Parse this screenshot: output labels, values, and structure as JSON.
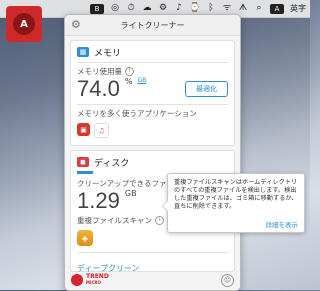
{
  "menubar": {
    "badge": "B",
    "items": [
      "◎",
      "⏱",
      "☁",
      "⚙",
      "♪",
      "⌚",
      "ᛒ",
      "ᯤ",
      "ᗑ",
      "⌕"
    ],
    "input_badge": "A",
    "input_label": "英字"
  },
  "desktop": {
    "app_icon_label": "A"
  },
  "panel": {
    "title": "ライトクリーナー",
    "memory": {
      "title": "メモリ",
      "usage_label": "メモリ使用量",
      "usage_value": "74.0",
      "usage_unit_pct": "%",
      "usage_unit_gb": "GB",
      "optimize_button": "最適化",
      "apps_label": "メモリを多く使うアプリケーション"
    },
    "disk": {
      "title": "ディスク",
      "cleanup_label": "クリーンアップできるファイル",
      "cleanup_value": "1.29",
      "cleanup_unit": "GB",
      "duplicate_label": "重複ファイルスキャン",
      "deep_clean_link": "ディープクリーン"
    },
    "footer": {
      "logo_line1": "TREND",
      "logo_line2": "MICRO"
    }
  },
  "tooltip": {
    "text": "重複ファイルスキャンはホームディレクトリのすべての重複ファイルを検出します。検出した重複ファイルは、ゴミ箱に移動するか、直ちに削除できます。",
    "link": "詳細を表示"
  },
  "colors": {
    "accent": "#2d8fdb",
    "brand_red": "#d8232a"
  }
}
